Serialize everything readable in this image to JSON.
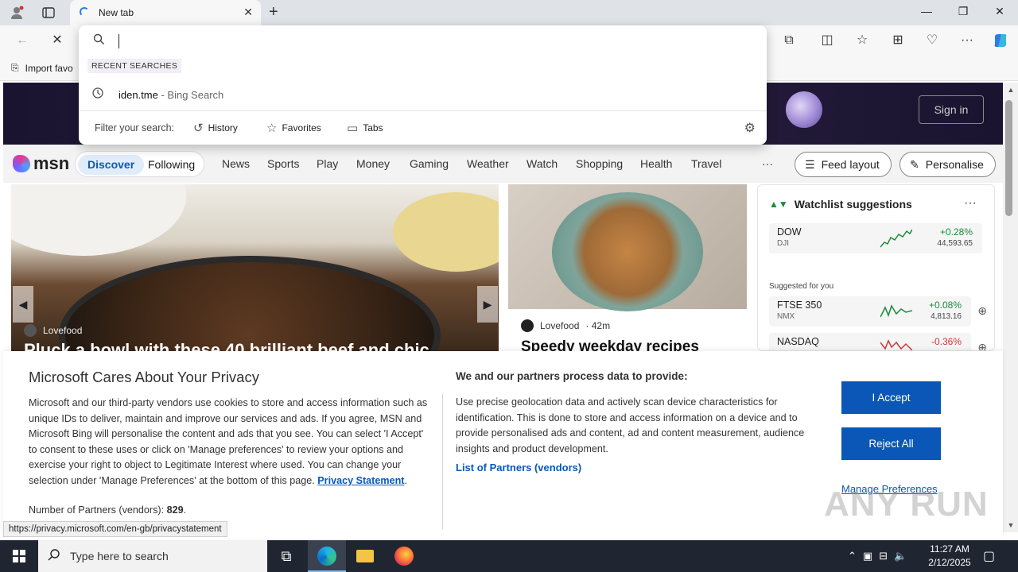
{
  "browser": {
    "tab_title": "New tab",
    "window_controls": {
      "minimize": "—",
      "restore": "❐",
      "close": "✕"
    },
    "favorites_bar": {
      "import_label": "Import favo"
    }
  },
  "omnibox": {
    "value": "",
    "recent_label": "RECENT SEARCHES",
    "recent": [
      {
        "query": "iden.tme",
        "source": " - Bing Search"
      }
    ],
    "filter_label": "Filter your search:",
    "filters": [
      {
        "label": "History",
        "icon": "history-icon"
      },
      {
        "label": "Favorites",
        "icon": "star-icon"
      },
      {
        "label": "Tabs",
        "icon": "tabs-icon"
      }
    ]
  },
  "msn": {
    "sign_in": "Sign in",
    "logo_text": "msn",
    "pills": [
      "Discover",
      "Following"
    ],
    "nav": [
      "News",
      "Sports",
      "Play",
      "Money",
      "Gaming",
      "Weather",
      "Watch",
      "Shopping",
      "Health",
      "Travel"
    ],
    "more": "···",
    "feed_layout": "Feed layout",
    "personalise": "Personalise",
    "main_card": {
      "source": "Lovefood",
      "title": "Pluck a bowl with these 40 brilliant beef and chic"
    },
    "second_card": {
      "source": "Lovefood",
      "age": "· 42m",
      "title": "Speedy weekday recipes"
    },
    "watchlist": {
      "title": "Watchlist suggestions",
      "more": "···",
      "suggested_label": "Suggested for you",
      "stocks": [
        {
          "symbol": "DOW",
          "sub": "DJI",
          "change": "+0.28%",
          "price": "44,593.65",
          "trend": "up"
        },
        {
          "symbol": "FTSE 350",
          "sub": "NMX",
          "change": "+0.08%",
          "price": "4,813.16",
          "trend": "up"
        },
        {
          "symbol": "NASDAQ",
          "sub": "",
          "change": "-0.36%",
          "price": "",
          "trend": "down"
        }
      ]
    }
  },
  "privacy": {
    "title": "Microsoft Cares About Your Privacy",
    "body": "Microsoft and our third-party vendors use cookies to store and access information such as unique IDs to deliver, maintain and improve our services and ads. If you agree, MSN and Microsoft Bing will personalise the content and ads that you see. You can select 'I Accept' to consent to these uses or click on 'Manage preferences' to review your options and exercise your right to object to Legitimate Interest where used.  You can change your selection under 'Manage Preferences' at the bottom of this page.",
    "privacy_link": "Privacy Statement",
    "partners_label": "Number of Partners (vendors): ",
    "partners_count": "829",
    "process_title": "We and our partners process data to provide:",
    "process_body": "Use precise geolocation data and actively scan device characteristics for identification. This is done to store and access information on a device and to provide personalised ads and content, ad and content measurement, audience insights and product development.",
    "vendors_link": "List of Partners (vendors)",
    "accept": "I Accept",
    "reject": "Reject All",
    "manage": "Manage Preferences"
  },
  "status_url": "https://privacy.microsoft.com/en-gb/privacystatement",
  "watermark": "ANY RUN",
  "taskbar": {
    "search_placeholder": "Type here to search",
    "time": "11:27 AM",
    "date": "2/12/2025"
  },
  "colors": {
    "accent": "#0a57b7",
    "stock_up": "#1a8a3a",
    "stock_down": "#d13438"
  }
}
